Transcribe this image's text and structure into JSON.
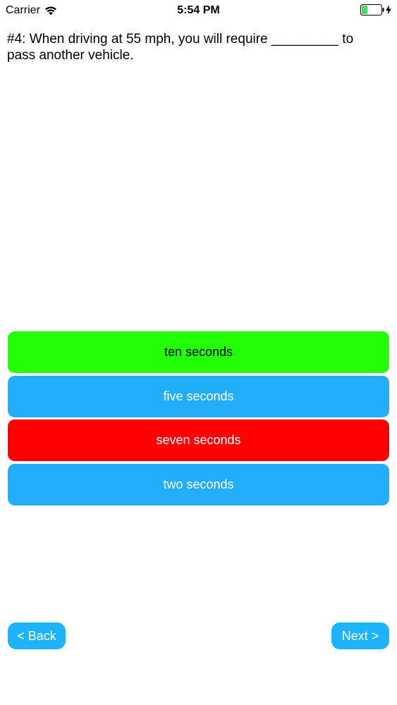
{
  "status_bar": {
    "carrier": "Carrier",
    "time": "5:54 PM",
    "battery_level": 0.3,
    "icons": [
      "wifi-icon",
      "battery-icon",
      "charging-icon"
    ]
  },
  "question": {
    "text": "#4: When driving at 55 mph, you will require _________ to pass another vehicle."
  },
  "answers": [
    {
      "label": "ten seconds",
      "state": "correct",
      "bg": "#22ff07",
      "fg": "#000000"
    },
    {
      "label": "five seconds",
      "state": "neutral",
      "bg": "#23aef9",
      "fg": "#ffffff"
    },
    {
      "label": "seven seconds",
      "state": "wrong",
      "bg": "#ff0000",
      "fg": "#ffffff"
    },
    {
      "label": "two seconds",
      "state": "neutral",
      "bg": "#23aef9",
      "fg": "#ffffff"
    }
  ],
  "nav": {
    "back_label": "< Back",
    "next_label": "Next >"
  },
  "colors": {
    "accent": "#1eb3ff",
    "battery_fill": "#4cd964"
  }
}
